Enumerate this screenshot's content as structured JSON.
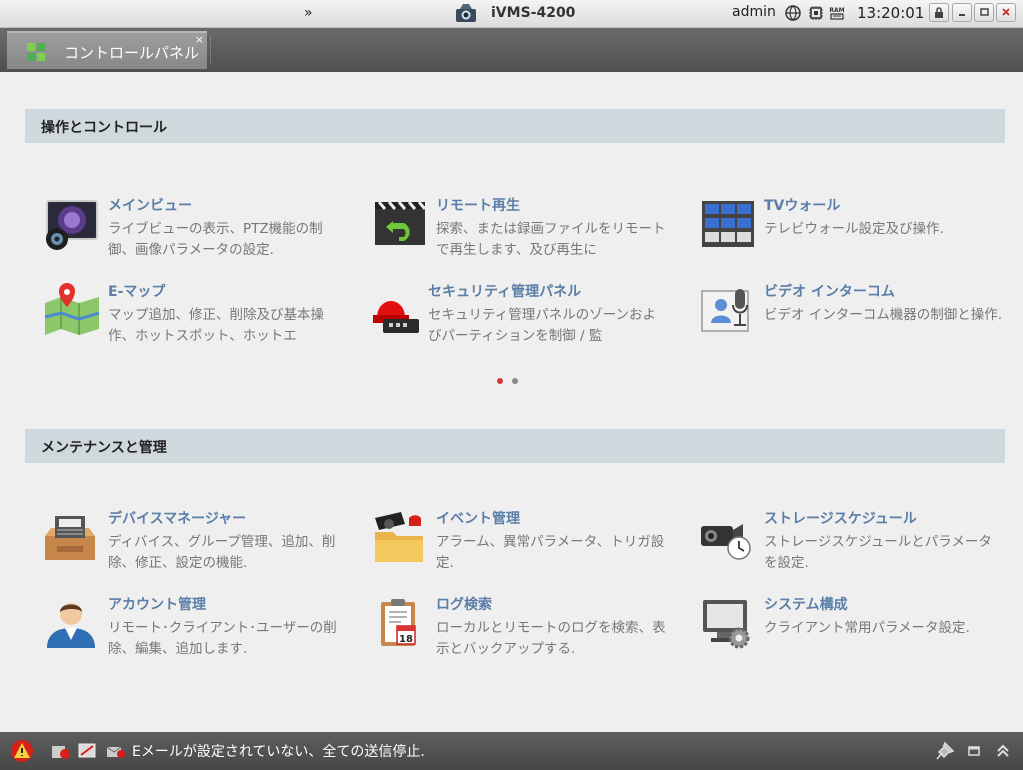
{
  "titlebar": {
    "chevron": "»",
    "app_title": "iVMS-4200",
    "user": "admin",
    "clock": "13:20:01",
    "icons": [
      "globe-icon",
      "cpu-icon",
      "ram-icon"
    ],
    "ram_label": "RAM",
    "buttons": [
      "lock-icon",
      "minimize-icon",
      "maximize-icon",
      "close-icon"
    ]
  },
  "tab": {
    "label": "コントロールパネル",
    "close": "×"
  },
  "sections": [
    {
      "title": "操作とコントロール",
      "items": [
        {
          "icon": "main-view-icon",
          "title": "メインビュー",
          "desc": "ライブビューの表示、PTZ機能の制御、画像パラメータの設定."
        },
        {
          "icon": "remote-playback-icon",
          "title": "リモート再生",
          "desc": "探索、または録画ファイルをリモートで再生します、及び再生に"
        },
        {
          "icon": "tv-wall-icon",
          "title": "TVウォール",
          "desc": "テレビウォール設定及び操作."
        },
        {
          "icon": "e-map-icon",
          "title": "E-マップ",
          "desc": "マップ追加、修正、削除及び基本操作、ホットスポット、ホットエ"
        },
        {
          "icon": "security-panel-icon",
          "title": "セキュリティ管理パネル",
          "desc": "セキュリティ管理パネルのゾーンおよびパーティションを制御 / 監"
        },
        {
          "icon": "video-intercom-icon",
          "title": "ビデオ インターコム",
          "desc": "ビデオ インターコム機器の制御と操作."
        }
      ]
    },
    {
      "title": "メンテナンスと管理",
      "items": [
        {
          "icon": "device-manager-icon",
          "title": "デバイスマネージャー",
          "desc": "ディバイス、グループ管理、追加、削除、修正、設定の機能."
        },
        {
          "icon": "event-management-icon",
          "title": "イベント管理",
          "desc": "アラーム、異常パラメータ、トリガ設定."
        },
        {
          "icon": "storage-schedule-icon",
          "title": "ストレージスケジュール",
          "desc": "ストレージスケジュールとパラメータを設定."
        },
        {
          "icon": "account-management-icon",
          "title": "アカウント管理",
          "desc": "リモート･クライアント･ユーザーの削除、編集、追加します."
        },
        {
          "icon": "log-search-icon",
          "title": "ログ検索",
          "desc": "ローカルとリモートのログを検索、表示とバックアップする."
        },
        {
          "icon": "system-config-icon",
          "title": "システム構成",
          "desc": "クライアント常用パラメータ設定."
        }
      ]
    }
  ],
  "pager": {
    "active": 0,
    "count": 2,
    "active_color": "#d9363a",
    "inactive_color": "#888888"
  },
  "status": {
    "text": "Eメールが設定されていない、全ての送信停止.",
    "left_icons": [
      "alarm-warning-icon",
      "device-alert-icon",
      "video-alert-icon",
      "email-alert-icon"
    ],
    "right_icons": [
      "pin-icon",
      "window-icon",
      "collapse-up-icon"
    ]
  },
  "colors": {
    "title_link": "#5a7ea7",
    "section_bg": "#cfd8dd",
    "tab_bg": "#8f8f8f"
  }
}
